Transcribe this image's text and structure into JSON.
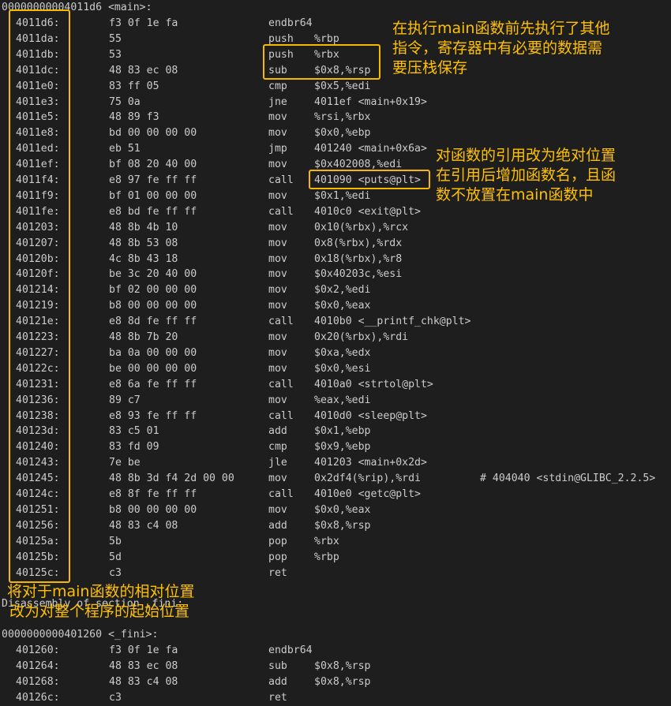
{
  "main_header": "00000000004011d6 <main>:",
  "rows": [
    {
      "addr": "4011d6:",
      "bytes": "f3 0f 1e fa",
      "mnem": "endbr64",
      "op": "",
      "comment": ""
    },
    {
      "addr": "4011da:",
      "bytes": "55",
      "mnem": "push",
      "op": "%rbp",
      "comment": ""
    },
    {
      "addr": "4011db:",
      "bytes": "53",
      "mnem": "push",
      "op": "%rbx",
      "comment": ""
    },
    {
      "addr": "4011dc:",
      "bytes": "48 83 ec 08",
      "mnem": "sub",
      "op": "$0x8,%rsp",
      "comment": ""
    },
    {
      "addr": "4011e0:",
      "bytes": "83 ff 05",
      "mnem": "cmp",
      "op": "$0x5,%edi",
      "comment": ""
    },
    {
      "addr": "4011e3:",
      "bytes": "75 0a",
      "mnem": "jne",
      "op": "4011ef <main+0x19>",
      "comment": ""
    },
    {
      "addr": "4011e5:",
      "bytes": "48 89 f3",
      "mnem": "mov",
      "op": "%rsi,%rbx",
      "comment": ""
    },
    {
      "addr": "4011e8:",
      "bytes": "bd 00 00 00 00",
      "mnem": "mov",
      "op": "$0x0,%ebp",
      "comment": ""
    },
    {
      "addr": "4011ed:",
      "bytes": "eb 51",
      "mnem": "jmp",
      "op": "401240 <main+0x6a>",
      "comment": ""
    },
    {
      "addr": "4011ef:",
      "bytes": "bf 08 20 40 00",
      "mnem": "mov",
      "op": "$0x402008,%edi",
      "comment": ""
    },
    {
      "addr": "4011f4:",
      "bytes": "e8 97 fe ff ff",
      "mnem": "call",
      "op": "401090 <puts@plt>",
      "comment": ""
    },
    {
      "addr": "4011f9:",
      "bytes": "bf 01 00 00 00",
      "mnem": "mov",
      "op": "$0x1,%edi",
      "comment": ""
    },
    {
      "addr": "4011fe:",
      "bytes": "e8 bd fe ff ff",
      "mnem": "call",
      "op": "4010c0 <exit@plt>",
      "comment": ""
    },
    {
      "addr": "401203:",
      "bytes": "48 8b 4b 10",
      "mnem": "mov",
      "op": "0x10(%rbx),%rcx",
      "comment": ""
    },
    {
      "addr": "401207:",
      "bytes": "48 8b 53 08",
      "mnem": "mov",
      "op": "0x8(%rbx),%rdx",
      "comment": ""
    },
    {
      "addr": "40120b:",
      "bytes": "4c 8b 43 18",
      "mnem": "mov",
      "op": "0x18(%rbx),%r8",
      "comment": ""
    },
    {
      "addr": "40120f:",
      "bytes": "be 3c 20 40 00",
      "mnem": "mov",
      "op": "$0x40203c,%esi",
      "comment": ""
    },
    {
      "addr": "401214:",
      "bytes": "bf 02 00 00 00",
      "mnem": "mov",
      "op": "$0x2,%edi",
      "comment": ""
    },
    {
      "addr": "401219:",
      "bytes": "b8 00 00 00 00",
      "mnem": "mov",
      "op": "$0x0,%eax",
      "comment": ""
    },
    {
      "addr": "40121e:",
      "bytes": "e8 8d fe ff ff",
      "mnem": "call",
      "op": "4010b0 <__printf_chk@plt>",
      "comment": ""
    },
    {
      "addr": "401223:",
      "bytes": "48 8b 7b 20",
      "mnem": "mov",
      "op": "0x20(%rbx),%rdi",
      "comment": ""
    },
    {
      "addr": "401227:",
      "bytes": "ba 0a 00 00 00",
      "mnem": "mov",
      "op": "$0xa,%edx",
      "comment": ""
    },
    {
      "addr": "40122c:",
      "bytes": "be 00 00 00 00",
      "mnem": "mov",
      "op": "$0x0,%esi",
      "comment": ""
    },
    {
      "addr": "401231:",
      "bytes": "e8 6a fe ff ff",
      "mnem": "call",
      "op": "4010a0 <strtol@plt>",
      "comment": ""
    },
    {
      "addr": "401236:",
      "bytes": "89 c7",
      "mnem": "mov",
      "op": "%eax,%edi",
      "comment": ""
    },
    {
      "addr": "401238:",
      "bytes": "e8 93 fe ff ff",
      "mnem": "call",
      "op": "4010d0 <sleep@plt>",
      "comment": ""
    },
    {
      "addr": "40123d:",
      "bytes": "83 c5 01",
      "mnem": "add",
      "op": "$0x1,%ebp",
      "comment": ""
    },
    {
      "addr": "401240:",
      "bytes": "83 fd 09",
      "mnem": "cmp",
      "op": "$0x9,%ebp",
      "comment": ""
    },
    {
      "addr": "401243:",
      "bytes": "7e be",
      "mnem": "jle",
      "op": "401203 <main+0x2d>",
      "comment": ""
    },
    {
      "addr": "401245:",
      "bytes": "48 8b 3d f4 2d 00 00",
      "mnem": "mov",
      "op": "0x2df4(%rip),%rdi",
      "comment": "# 404040 <stdin@GLIBC_2.2.5>"
    },
    {
      "addr": "40124c:",
      "bytes": "e8 8f fe ff ff",
      "mnem": "call",
      "op": "4010e0 <getc@plt>",
      "comment": ""
    },
    {
      "addr": "401251:",
      "bytes": "b8 00 00 00 00",
      "mnem": "mov",
      "op": "$0x0,%eax",
      "comment": ""
    },
    {
      "addr": "401256:",
      "bytes": "48 83 c4 08",
      "mnem": "add",
      "op": "$0x8,%rsp",
      "comment": ""
    },
    {
      "addr": "40125a:",
      "bytes": "5b",
      "mnem": "pop",
      "op": "%rbx",
      "comment": ""
    },
    {
      "addr": "40125b:",
      "bytes": "5d",
      "mnem": "pop",
      "op": "%rbp",
      "comment": ""
    },
    {
      "addr": "40125c:",
      "bytes": "c3",
      "mnem": "ret",
      "op": "",
      "comment": ""
    }
  ],
  "fini_section_line": "Disassembly of section .fini:",
  "fini_header": "0000000000401260 <_fini>:",
  "fini_rows": [
    {
      "addr": "401260:",
      "bytes": "f3 0f 1e fa",
      "mnem": "endbr64",
      "op": ""
    },
    {
      "addr": "401264:",
      "bytes": "48 83 ec 08",
      "mnem": "sub",
      "op": "$0x8,%rsp"
    },
    {
      "addr": "401268:",
      "bytes": "48 83 c4 08",
      "mnem": "add",
      "op": "$0x8,%rsp"
    },
    {
      "addr": "40126c:",
      "bytes": "c3",
      "mnem": "ret",
      "op": ""
    }
  ],
  "annotations": {
    "stack_note": [
      "在执行main函数前先执行了其他",
      "指令，寄存器中有必要的数据需",
      "要压栈保存"
    ],
    "call_note": [
      "对函数的引用改为绝对位置",
      "在引用后增加函数名，且函",
      "数不放置在main函数中"
    ],
    "addr_note": [
      "将对于main函数的相对位置",
      "改为对整个程序的起始位置"
    ]
  },
  "colors": {
    "background": "#1e1e1e",
    "text": "#cccccc",
    "highlight": "#ffc000"
  }
}
